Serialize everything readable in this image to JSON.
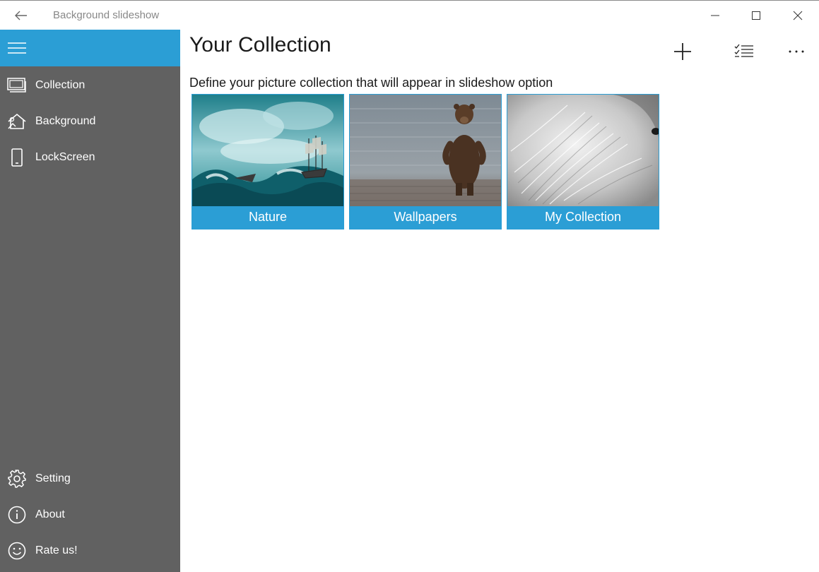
{
  "window": {
    "title": "Background slideshow"
  },
  "sidebar": {
    "top_items": [
      {
        "label": "Collection",
        "icon": "collection-icon"
      },
      {
        "label": "Background",
        "icon": "background-icon"
      },
      {
        "label": "LockScreen",
        "icon": "lockscreen-icon"
      }
    ],
    "bottom_items": [
      {
        "label": "Setting",
        "icon": "gear-icon"
      },
      {
        "label": "About",
        "icon": "info-icon"
      },
      {
        "label": "Rate us!",
        "icon": "smiley-icon"
      }
    ],
    "colors": {
      "background": "#616161",
      "accent": "#2b9ed5"
    }
  },
  "main": {
    "title": "Your Collection",
    "subtitle": "Define your picture collection that will appear in slideshow option",
    "commands": [
      "add-icon",
      "select-list-icon",
      "more-icon"
    ],
    "tiles": [
      {
        "label": "Nature",
        "image": "stormy-sea-ship-painting"
      },
      {
        "label": "Wallpapers",
        "image": "bear-standing-in-water"
      },
      {
        "label": "My Collection",
        "image": "white-fur-closeup"
      }
    ]
  }
}
